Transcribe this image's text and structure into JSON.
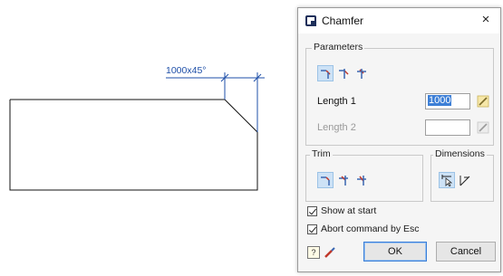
{
  "drawing": {
    "dimension_label": "1000x45°"
  },
  "dialog": {
    "title": "Chamfer",
    "close_glyph": "×",
    "parameters": {
      "label": "Parameters",
      "length1_label": "Length 1",
      "length1_value": "1000",
      "length2_label": "Length 2",
      "length2_value": ""
    },
    "trim": {
      "label": "Trim"
    },
    "dimensions": {
      "label": "Dimensions"
    },
    "options": {
      "show_at_start": "Show at start",
      "abort_by_esc": "Abort command by Esc"
    },
    "buttons": {
      "ok": "OK",
      "cancel": "Cancel"
    }
  },
  "colors": {
    "accent": "#1e4fa8",
    "selection": "#3d7fd6",
    "active_bg": "#cde2f6"
  }
}
